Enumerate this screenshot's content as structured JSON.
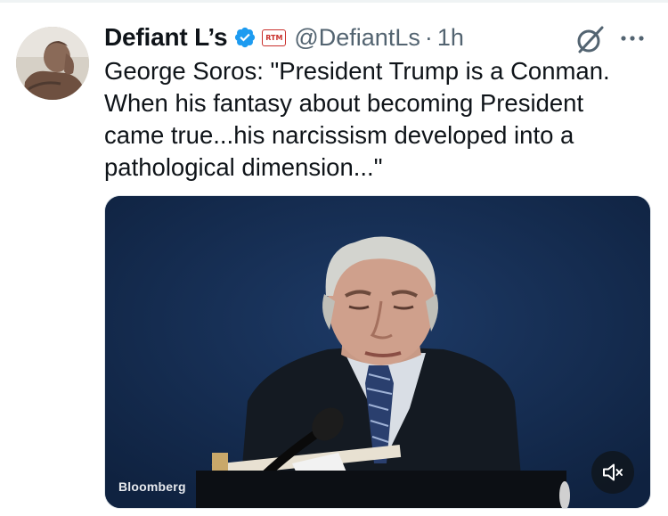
{
  "tweet": {
    "author": {
      "display_name": "Defiant L’s",
      "handle": "@DefiantLs",
      "verified": true,
      "affiliate_badge_text": "RTM"
    },
    "separator": "·",
    "timestamp": "1h",
    "text": "George Soros: \"President Trump is a Conman.\nWhen his fantasy about becoming President\ncame true...his narcissism developed into a\npathological dimension...\"",
    "media": {
      "type": "video",
      "watermark": "Bloomberg",
      "muted": true
    }
  },
  "icons": {
    "verified": "verified-checkmark-icon",
    "grok": "grok-icon",
    "more": "more-options-icon",
    "mute": "speaker-muted-icon"
  },
  "colors": {
    "verified_blue": "#1d9bf0",
    "text_primary": "#0f1419",
    "text_secondary": "#536471",
    "video_background": "#152c4f",
    "badge_red": "#c9302c"
  }
}
